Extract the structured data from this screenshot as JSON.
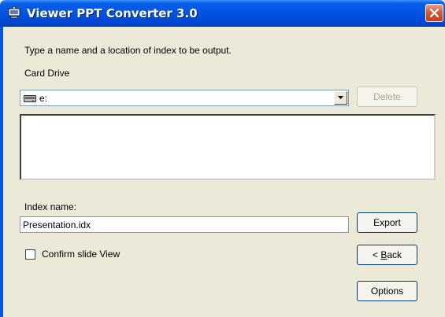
{
  "window": {
    "title": "Viewer PPT Converter 3.0",
    "icon": "converter-app-icon",
    "close_icon": "close-icon",
    "accent_color": "#0054e3",
    "close_color": "#d45a3c"
  },
  "form": {
    "instruction": "Type a name and a location of index to be output.",
    "card_drive_label": "Card Drive",
    "card_drive_value": "e:",
    "drive_icon": "removable-drive-icon",
    "index_name_label": "Index name:",
    "index_name_value": "Presentation.idx",
    "confirm_label": "Confirm slide View",
    "confirm_checked": false
  },
  "buttons": {
    "delete": "Delete",
    "export": "Export",
    "back_prefix": "< ",
    "back_mnemonic": "B",
    "back_rest": "ack",
    "options": "Options"
  }
}
